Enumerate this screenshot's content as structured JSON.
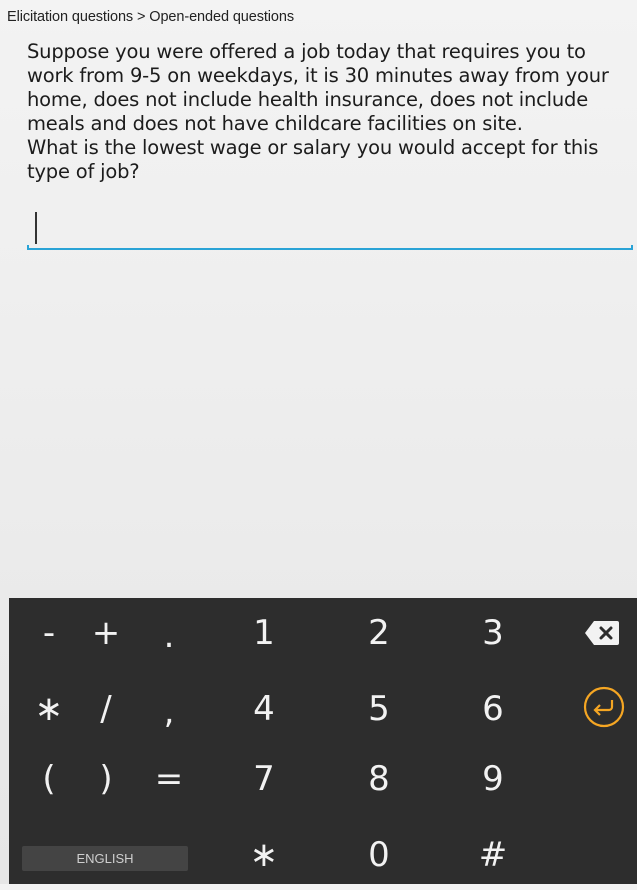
{
  "breadcrumb": "Elicitation questions > Open-ended questions",
  "question": {
    "line1": "Suppose you were offered a job today that requires you to work from 9-5 on weekdays, it is 30 minutes away from your home, does not include health insurance, does not include meals and does not have childcare facilities on site.",
    "line2": "What is the lowest wage or salary you would accept for this type of job?"
  },
  "answer": {
    "value": "",
    "placeholder": ""
  },
  "keyboard": {
    "row1": [
      "-",
      "+",
      ".",
      "1",
      "2",
      "3"
    ],
    "row2": [
      "∗",
      "/",
      ",",
      "4",
      "5",
      "6"
    ],
    "row3": [
      "(",
      ")",
      "=",
      "7",
      "8",
      "9"
    ],
    "row4": [
      "∗",
      "0",
      "#"
    ],
    "language_label": "ENGLISH",
    "backspace_icon": "backspace-icon",
    "enter_icon": "enter-icon",
    "accent_color": "#f5a623"
  }
}
